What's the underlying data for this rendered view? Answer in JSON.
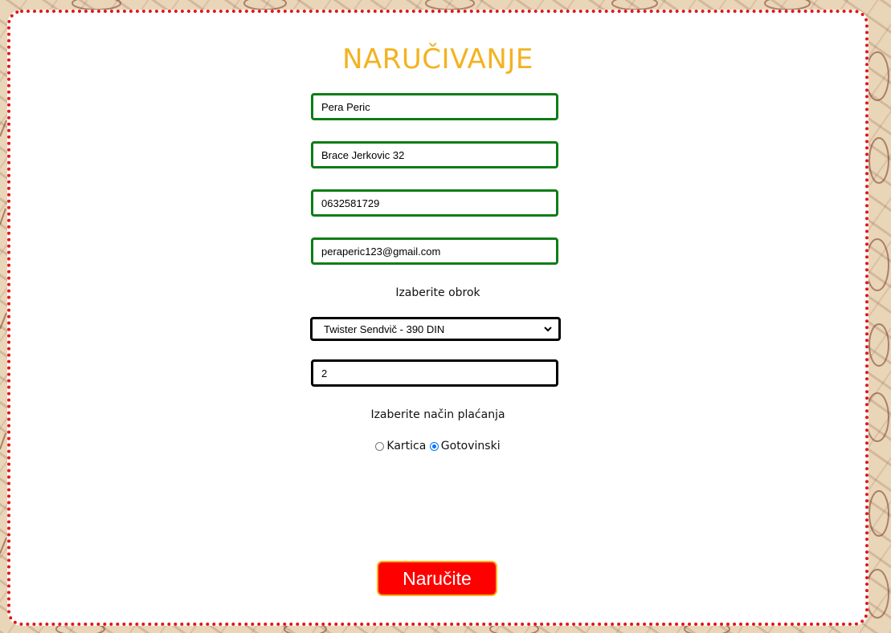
{
  "form": {
    "title": "NARUČIVANJE",
    "fields": {
      "name": "Pera Peric",
      "address": "Brace Jerkovic 32",
      "phone": "0632581729",
      "email": "peraperic123@gmail.com",
      "quantity": "2"
    },
    "meal_label": "Izaberite obrok",
    "meal_selected": "Twister Sendvič - 390 DIN",
    "payment_label": "Izaberite način plaćanja",
    "payment_options": [
      "Kartica",
      "Gotovinski"
    ],
    "payment_selected": "Gotovinski",
    "submit_label": "Naručite"
  },
  "colors": {
    "title": "#f3b221",
    "field_border_valid": "#0d7d16",
    "card_border": "#e11616",
    "button_bg": "#ff0000",
    "button_border": "#f5b020",
    "radio_checked": "#0075ff",
    "page_background": "#e9d5b8"
  },
  "icons": {
    "select_arrow": "chevron-down-icon",
    "background_pattern": "sandwich-doodle-pattern"
  }
}
